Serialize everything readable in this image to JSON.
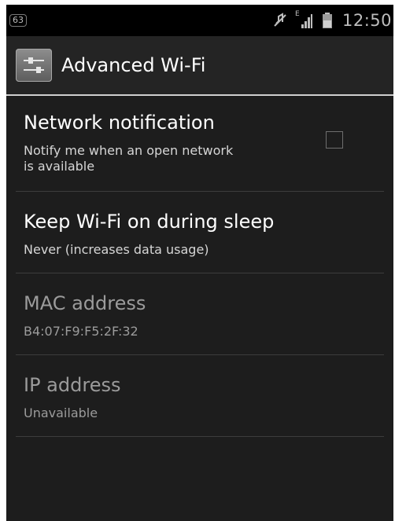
{
  "status_bar": {
    "notification_count": "63",
    "network_type": "E",
    "time": "12:50",
    "icons": [
      "mute-icon",
      "signal-icon",
      "battery-icon"
    ]
  },
  "action_bar": {
    "icon": "settings-sliders-icon",
    "title": "Advanced Wi-Fi"
  },
  "preferences": [
    {
      "title": "Network notification",
      "summary": "Notify me when an open network is available",
      "summary_line1": "Notify me when an open network",
      "summary_line2": "is available",
      "checked": false,
      "enabled": true
    },
    {
      "title": "Keep Wi-Fi on during sleep",
      "summary": "Never (increases data usage)",
      "enabled": true
    },
    {
      "title": "MAC address",
      "summary": "B4:07:F9:F5:2F:32",
      "enabled": false
    },
    {
      "title": "IP address",
      "summary": "Unavailable",
      "enabled": false
    }
  ],
  "colors": {
    "background": "#1d1d1d",
    "status_bar": "#000000",
    "action_bar": "#242424",
    "divider": "#3d3d3d"
  }
}
